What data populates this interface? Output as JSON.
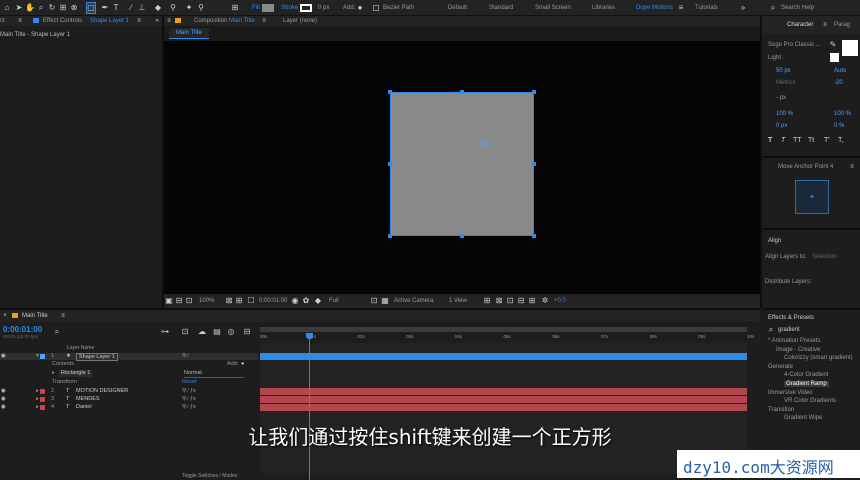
{
  "toolbar": {
    "fill_label": "Fill",
    "stroke_label": "Stroke",
    "stroke_px": "0 px",
    "add_label": "Add:",
    "bezier_label": "Bezier Path",
    "workspaces": [
      "Default",
      "Standard",
      "Small Screen",
      "Libraries",
      "Dope Motions",
      "Tutorials"
    ],
    "search_placeholder": "Search Help"
  },
  "left_panel": {
    "tab_prefix": "Effect Controls",
    "tab_layer": "Shape Layer 1",
    "cut_label": "ct",
    "subtitle": "Main Title - Shape Layer 1"
  },
  "comp_panel": {
    "tab_prefix": "Composition",
    "tab_name": "Main Title",
    "layer_tab": "Layer (none)",
    "breadcrumb": "Main Title",
    "zoom": "100%",
    "timecode": "0:00:01:00",
    "resolution": "Full",
    "camera": "Active Camera",
    "views": "1 View",
    "exposure": "+0.0"
  },
  "character": {
    "tab": "Character",
    "tab2": "Parag",
    "font": "Sogo Pro Classic ...",
    "style": "Light",
    "size": "50 px",
    "leading": "Auto",
    "kerning": "Metrics",
    "tracking": "-20",
    "stroke_w": "- px",
    "vscale": "100 %",
    "hscale": "100 %",
    "baseline": "0 px",
    "tsume": "0 %",
    "tt": [
      "T",
      "T",
      "TT",
      "Tt",
      "T'",
      "T,"
    ]
  },
  "anchor": {
    "title": "Move Anchor Point 4"
  },
  "align": {
    "title": "Align",
    "align_to_label": "Align Layers to:",
    "align_to_value": "Selection",
    "distribute": "Distribute Layers:"
  },
  "effects": {
    "title": "Effects & Presets",
    "search": "gradient",
    "items": [
      {
        "t": "* Animation Presets",
        "lvl": 0
      },
      {
        "t": "Image - Creative",
        "lvl": 1
      },
      {
        "t": "Colorizzy (smart gradient)",
        "lvl": 2
      },
      {
        "t": "Generate",
        "lvl": 0
      },
      {
        "t": "4-Color Gradient",
        "lvl": 2
      },
      {
        "t": "Gradient Ramp",
        "lvl": 2,
        "sel": true
      },
      {
        "t": "Immersive Video",
        "lvl": 0
      },
      {
        "t": "VR Color Gradients",
        "lvl": 2
      },
      {
        "t": "Transition",
        "lvl": 0
      },
      {
        "t": "Gradient Wipe",
        "lvl": 2
      }
    ]
  },
  "timeline": {
    "tab": "Main Title",
    "timecode": "0:00:01:00",
    "frames": "00025 (25.00 fps)",
    "col_name": "Layer Name",
    "ruler": [
      "00s",
      "01s",
      "02s",
      "03s",
      "04s",
      "05s",
      "06s",
      "07s",
      "08s",
      "09s",
      "10s"
    ],
    "layers": [
      {
        "num": "1",
        "name": "Shape Layer 1",
        "star": true
      },
      {
        "num": "2",
        "name": "MOTION DESIGNER"
      },
      {
        "num": "3",
        "name": "MENDES"
      },
      {
        "num": "4",
        "name": "Daniel"
      }
    ],
    "contents": "Contents",
    "add_label": "Add:",
    "rect": "Rectangle 1",
    "blend": "Normal",
    "transform": "Transform",
    "reset": "Reset",
    "toggle": "Toggle Switches / Modes"
  },
  "subtitle": "让我们通过按住shift键来创建一个正方形",
  "watermark": "dzy10.com大资源网",
  "colors": {
    "accent": "#2d8ceb",
    "shape": "#8a8a8c",
    "layer_red": "#c44",
    "track_red": "#b0484e",
    "track_blue": "#2b8de0"
  }
}
